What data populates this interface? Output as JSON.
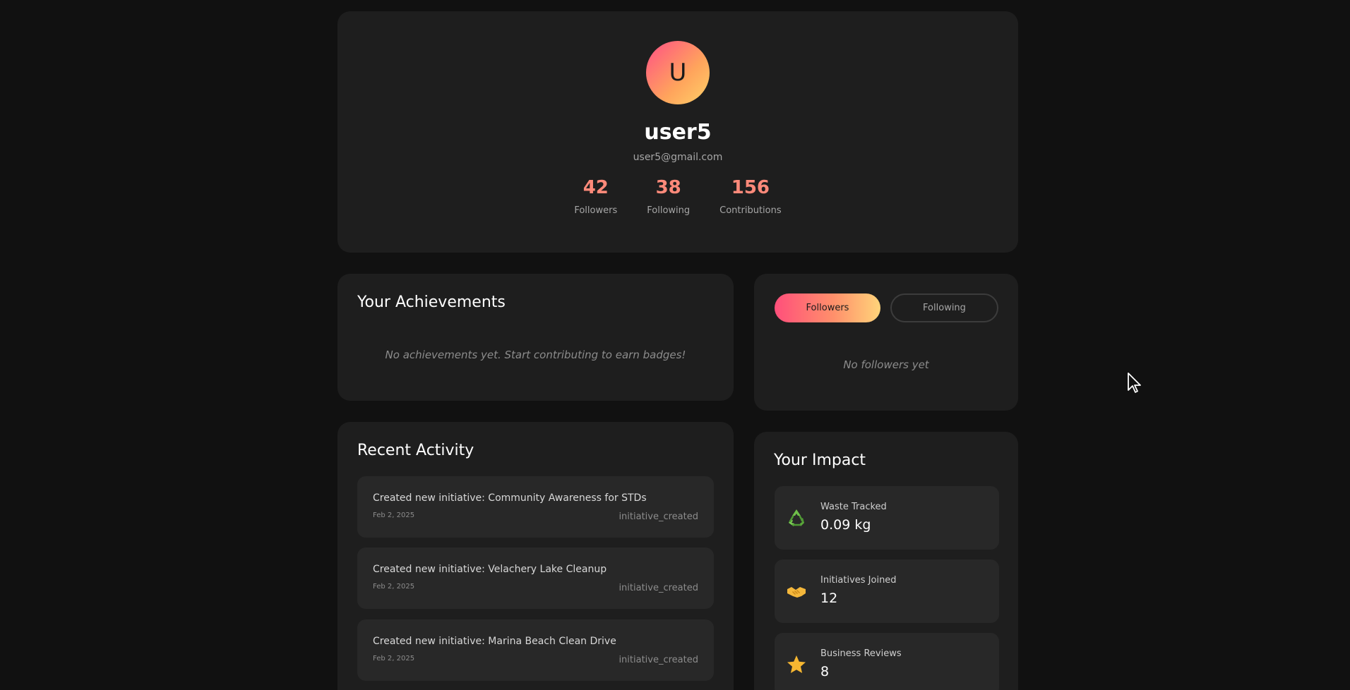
{
  "profile": {
    "avatar_initial": "U",
    "username": "user5",
    "email": "user5@gmail.com",
    "stats": [
      {
        "value": "42",
        "label": "Followers"
      },
      {
        "value": "38",
        "label": "Following"
      },
      {
        "value": "156",
        "label": "Contributions"
      }
    ]
  },
  "achievements": {
    "title": "Your Achievements",
    "empty_message": "No achievements yet. Start contributing to earn badges!"
  },
  "followers_panel": {
    "tabs": [
      {
        "label": "Followers",
        "active": true
      },
      {
        "label": "Following",
        "active": false
      }
    ],
    "empty_message": "No followers yet"
  },
  "recent_activity": {
    "title": "Recent Activity",
    "items": [
      {
        "text": "Created new initiative: Community Awareness for STDs",
        "date": "Feb 2, 2025",
        "type": "initiative_created"
      },
      {
        "text": "Created new initiative: Velachery Lake Cleanup",
        "date": "Feb 2, 2025",
        "type": "initiative_created"
      },
      {
        "text": "Created new initiative: Marina Beach Clean Drive",
        "date": "Feb 2, 2025",
        "type": "initiative_created"
      }
    ]
  },
  "impact": {
    "title": "Your Impact",
    "items": [
      {
        "icon": "recycle-icon",
        "label": "Waste Tracked",
        "value": "0.09 kg"
      },
      {
        "icon": "handshake-icon",
        "label": "Initiatives Joined",
        "value": "12"
      },
      {
        "icon": "star-icon",
        "label": "Business Reviews",
        "value": "8"
      }
    ]
  },
  "colors": {
    "background": "#111111",
    "card": "#1e1e1e",
    "accent_pink": "#ff4f7b",
    "accent_orange": "#ff8a7a",
    "accent_yellow": "#ffd47a"
  }
}
